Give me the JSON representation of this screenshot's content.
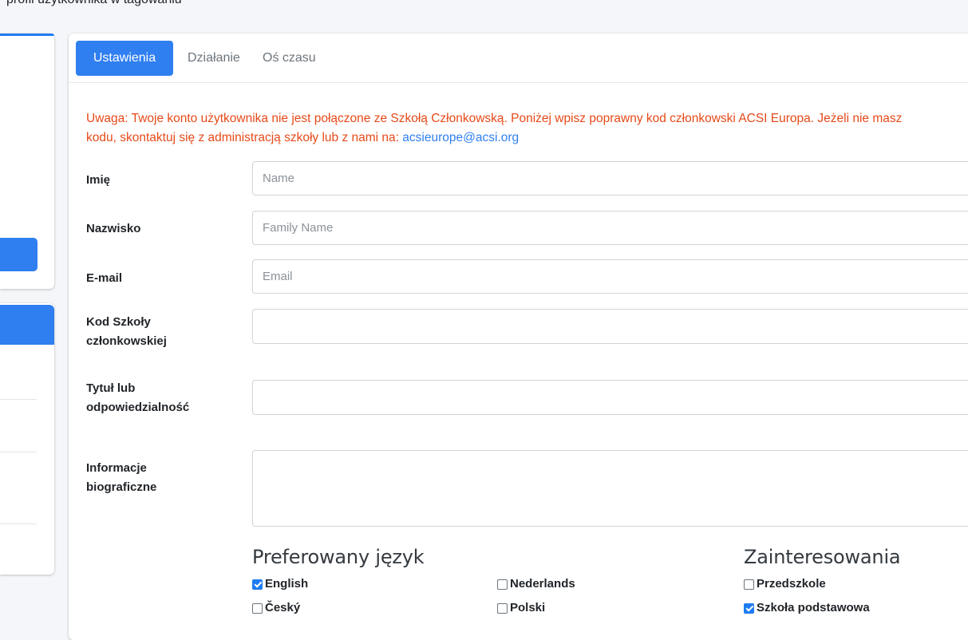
{
  "header": {
    "caption": "profil użytkownika w tagowaniu"
  },
  "tabs": [
    {
      "label": "Ustawienia",
      "active": true
    },
    {
      "label": "Działanie",
      "active": false
    },
    {
      "label": "Oś czasu",
      "active": false
    }
  ],
  "warning": {
    "line1": "Uwaga: Twoje konto użytkownika nie jest połączone ze Szkołą Członkowską. Poniżej wpisz poprawny kod członkowski ACSI Europa. Jeżeli nie masz",
    "line2_prefix": "kodu, skontaktuj się z administracją szkoły lub z nami na: ",
    "email": "acsieurope@acsi.org"
  },
  "form": {
    "first_name": {
      "label": "Imię",
      "placeholder": "Name",
      "value": ""
    },
    "last_name": {
      "label": "Nazwisko",
      "placeholder": "Family Name",
      "value": ""
    },
    "email": {
      "label": "E-mail",
      "placeholder": "Email",
      "value": ""
    },
    "school_code": {
      "label_line1": "Kod Szkoły",
      "label_line2": "członkowskiej",
      "value": ""
    },
    "title": {
      "label_line1": "Tytuł lub",
      "label_line2": "odpowiedzialność",
      "value": ""
    },
    "bio": {
      "label_line1": "Informacje",
      "label_line2": "biograficzne",
      "value": ""
    }
  },
  "preferred_language": {
    "title": "Preferowany język",
    "options": [
      {
        "label": "English",
        "checked": true
      },
      {
        "label": "Nederlands",
        "checked": false
      },
      {
        "label": "Český",
        "checked": false
      },
      {
        "label": "Polski",
        "checked": false
      }
    ]
  },
  "interests": {
    "title": "Zainteresowania",
    "options": [
      {
        "label": "Przedszkole",
        "checked": false
      },
      {
        "label": "Szkoła podstawowa",
        "checked": true
      }
    ]
  },
  "colors": {
    "accent": "#2f7ff0",
    "warning": "#e64a19"
  }
}
